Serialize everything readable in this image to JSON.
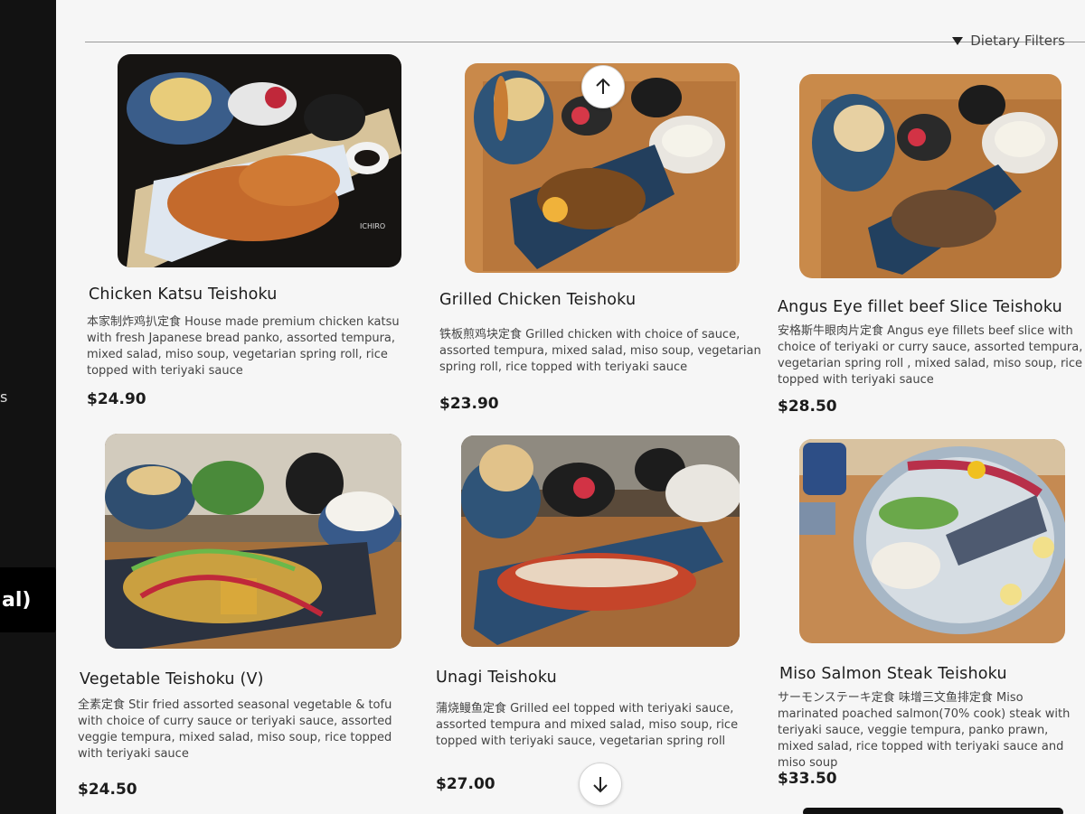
{
  "header": {
    "filter_label": "Dietary Filters"
  },
  "side_tab": {
    "label": "al)",
    "edge_letter": "s"
  },
  "menu_items": [
    {
      "name": "Chicken Katsu Teishoku",
      "description": "本家制炸鸡扒定食 House made premium chicken katsu with fresh Japanese bread panko, assorted tempura, mixed salad, miso soup, vegetarian spring roll, rice topped with teriyaki sauce",
      "price": "$24.90",
      "photo_watermark": "ICHIRO"
    },
    {
      "name": "Grilled Chicken Teishoku",
      "description": "铁板煎鸡块定食 Grilled chicken with choice of sauce, assorted tempura, mixed salad, miso soup, vegetarian spring roll, rice topped with teriyaki sauce",
      "price": "$23.90"
    },
    {
      "name": "Angus Eye fillet beef Slice Teishoku",
      "description": "安格斯牛眼肉片定食 Angus eye fillets beef slice with choice of teriyaki or curry sauce, assorted tempura, vegetarian spring roll , mixed salad, miso soup, rice topped with teriyaki sauce",
      "price": "$28.50"
    },
    {
      "name": "Vegetable Teishoku (V)",
      "description": "全素定食 Stir fried assorted seasonal vegetable & tofu with choice of curry sauce or teriyaki sauce, assorted veggie tempura, mixed salad, miso soup, rice topped with teriyaki sauce",
      "price": "$24.50"
    },
    {
      "name": "Unagi Teishoku",
      "description": "蒲烧鳗鱼定食 Grilled eel topped with teriyaki sauce, assorted tempura and mixed salad, miso soup, rice topped with teriyaki sauce, vegetarian spring roll",
      "price": "$27.00"
    },
    {
      "name": "Miso Salmon Steak Teishoku",
      "description": "サーモンステーキ定食 味增三文鱼排定食 Miso marinated poached salmon(70% cook) steak with teriyaki sauce, veggie tempura, panko prawn, mixed salad, rice topped with teriyaki sauce and miso soup",
      "price": "$33.50"
    }
  ],
  "icons": {
    "scroll_up": "arrow-up-icon",
    "scroll_down": "arrow-down-icon",
    "filter": "caret-down-icon"
  }
}
